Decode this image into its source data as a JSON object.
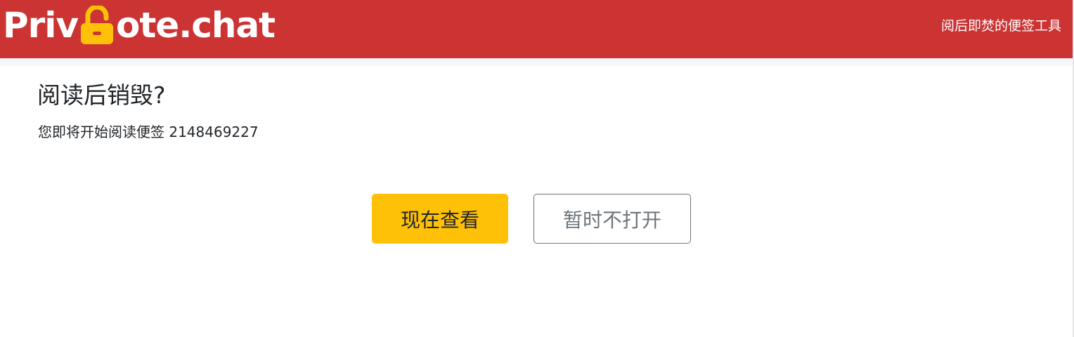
{
  "header": {
    "logo_before": "Priv",
    "logo_after": "ote.chat",
    "logo_icon": "open-padlock-icon",
    "tagline": "阅后即焚的便签工具",
    "brand_color": "#cc3333",
    "icon_color": "#ffc107"
  },
  "main": {
    "title": "阅读后销毁?",
    "subtitle": "您即将开始阅读便签 2148469227"
  },
  "actions": {
    "view_label": "现在查看",
    "cancel_label": "暂时不打开",
    "view_color": "#ffc107",
    "cancel_color": "#6c757d"
  }
}
